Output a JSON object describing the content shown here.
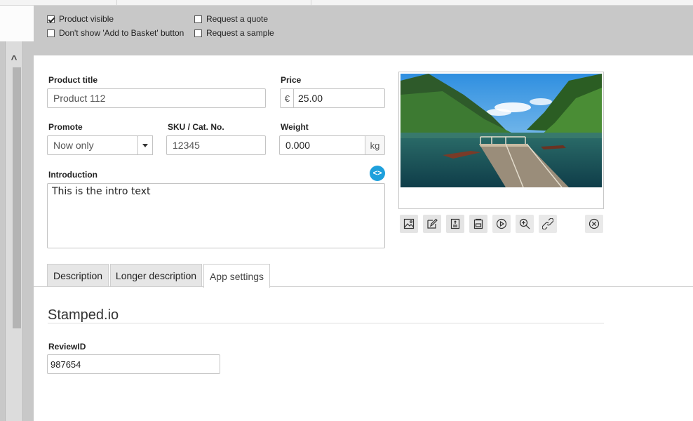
{
  "options": {
    "product_visible": {
      "label": "Product visible",
      "checked": true
    },
    "no_basket_button": {
      "label": "Don't show 'Add to Basket' button",
      "checked": false
    },
    "request_quote": {
      "label": "Request a quote",
      "checked": false
    },
    "request_sample": {
      "label": "Request a sample",
      "checked": false
    }
  },
  "form": {
    "product_title": {
      "label": "Product title",
      "value": "Product 112"
    },
    "price": {
      "label": "Price",
      "currency": "€",
      "value": "25.00"
    },
    "promote": {
      "label": "Promote",
      "value": "Now only"
    },
    "sku": {
      "label": "SKU / Cat. No.",
      "value": "12345"
    },
    "weight": {
      "label": "Weight",
      "value": "0.000",
      "unit": "kg"
    },
    "introduction": {
      "label": "Introduction",
      "value": "This is the intro text"
    }
  },
  "image_toolbar": [
    "image-icon",
    "edit-icon",
    "text-icon",
    "gallery-icon",
    "play-icon",
    "zoom-in-icon",
    "link-icon",
    "remove-icon"
  ],
  "tabs": [
    {
      "label": "Description",
      "active": false
    },
    {
      "label": "Longer description",
      "active": false
    },
    {
      "label": "App settings",
      "active": true
    }
  ],
  "app_settings": {
    "section_title": "Stamped.io",
    "review_id": {
      "label": "ReviewID",
      "value": "987654"
    }
  },
  "colors": {
    "accent": "#1ea0dc",
    "panel_gray": "#c8c8c8"
  }
}
